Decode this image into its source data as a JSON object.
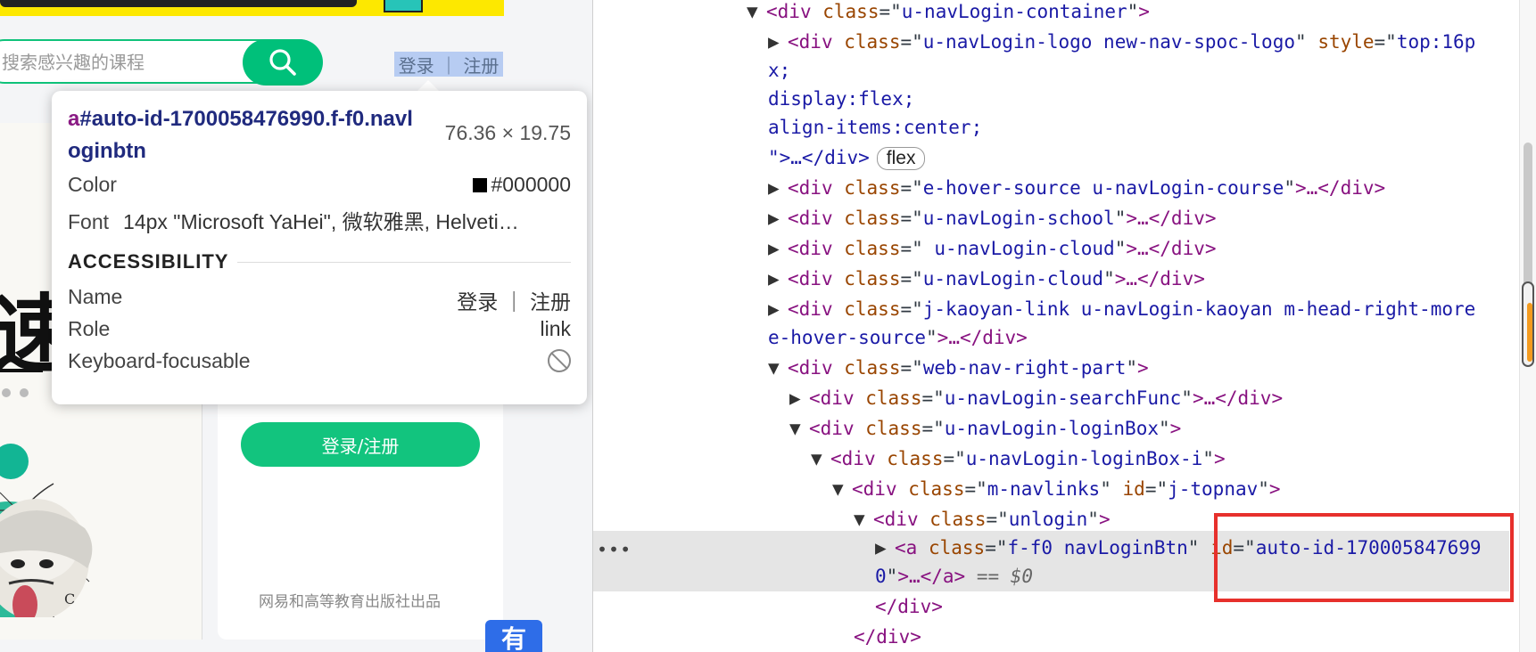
{
  "page": {
    "search_placeholder": "搜索感兴趣的课程",
    "login_link": "登录 ｜ 注册",
    "hero_glyph": "速",
    "login_register_button": "登录/注册",
    "publisher_text": "网易和高等教育出版社出品",
    "floating_tab": "有"
  },
  "tooltip": {
    "tag": "a",
    "selector": "#auto-id-1700058476990.f-f0.navloginbtn",
    "dimensions": "76.36 × 19.75",
    "color_label": "Color",
    "color_value": "#000000",
    "font_label": "Font",
    "font_value": "14px \"Microsoft YaHei\", 微软雅黑, Helveti…",
    "accessibility_heading": "ACCESSIBILITY",
    "name_label": "Name",
    "name_value": "登录 ｜ 注册",
    "role_label": "Role",
    "role_value": "link",
    "focusable_label": "Keyboard-focusable"
  },
  "elements_tree": {
    "line1": {
      "tag": "div",
      "attr": "class",
      "value": "u-navLogin-container"
    },
    "line2": {
      "tag": "div",
      "attr": "class",
      "value": "u-navLogin-logo new-nav-spoc-logo",
      "attr2": "style",
      "value2_start": "top:16p"
    },
    "line3": "x;",
    "line4": "display:flex;",
    "line5": "align-items:center;",
    "line6_text": "\">…</div>",
    "flex_badge": "flex",
    "line7": {
      "tag": "div",
      "attr": "class",
      "value": "e-hover-source u-navLogin-course",
      "tail": ">…</div>"
    },
    "line8": {
      "tag": "div",
      "attr": "class",
      "value": "u-navLogin-school",
      "tail": ">…</div>"
    },
    "line9": {
      "tag": "div",
      "attr": "class",
      "value": " u-navLogin-cloud",
      "tail": ">…</div>"
    },
    "line10": {
      "tag": "div",
      "attr": "class",
      "value": "u-navLogin-cloud",
      "tail": ">…</div>"
    },
    "line11": {
      "tag": "div",
      "attr": "class",
      "value": "j-kaoyan-link u-navLogin-kaoyan m-head-right-more"
    },
    "line12": {
      "value": "e-hover-source",
      "tail": ">…</div>"
    },
    "line13": {
      "tag": "div",
      "attr": "class",
      "value": "web-nav-right-part"
    },
    "line14": {
      "tag": "div",
      "attr": "class",
      "value": "u-navLogin-searchFunc",
      "tail": ">…</div>"
    },
    "line15": {
      "tag": "div",
      "attr": "class",
      "value": "u-navLogin-loginBox"
    },
    "line16": {
      "tag": "div",
      "attr": "class",
      "value": "u-navLogin-loginBox-i"
    },
    "line17": {
      "tag": "div",
      "attr": "class",
      "value": "m-navlinks",
      "attr2": "id",
      "value2": "j-topnav"
    },
    "line18": {
      "tag": "div",
      "attr": "class",
      "value": "unlogin"
    },
    "line19": {
      "tag": "a",
      "attr": "class",
      "value": "f-f0 navLoginBtn",
      "attr2": "id",
      "value2_start": "auto-id-170005847699"
    },
    "line20": {
      "value_end": "0",
      "tail": ">…</a>",
      "marker": "== $0"
    },
    "line21": "</div>",
    "line22": "</div>",
    "dots": "•••"
  },
  "colors": {
    "tag": "#881280",
    "attr_name": "#994500",
    "attr_value": "#1a1aa6",
    "brand_green": "#00c07a",
    "highlight_red": "#e7302c"
  }
}
